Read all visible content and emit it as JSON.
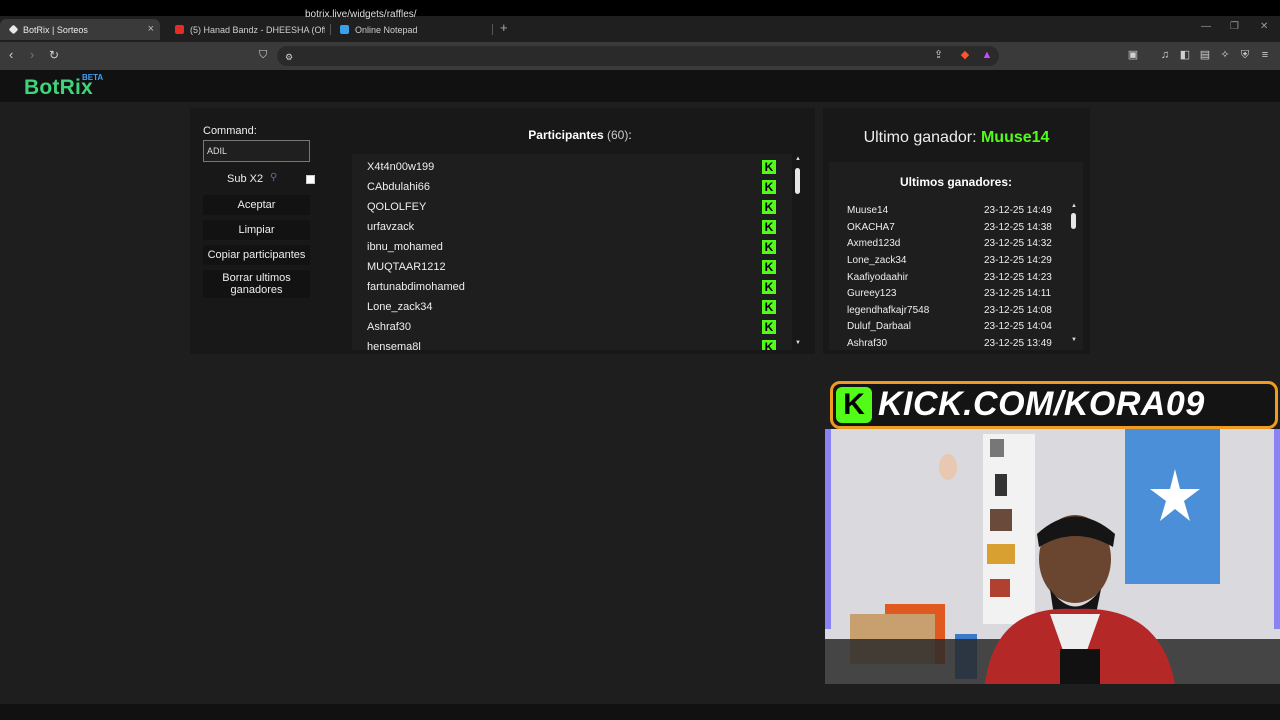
{
  "browser": {
    "tabs": [
      {
        "title": "BotRix | Sorteos",
        "fav_color": "#e8e8e8"
      },
      {
        "title": "(5) Hanad Bandz - DHEESHA (Official",
        "fav_color": "#e52d27"
      },
      {
        "title": "Online Notepad",
        "fav_color": "#3aa0e8"
      }
    ],
    "url": "botrix.live/widgets/raffles/"
  },
  "site": {
    "logo": "BotRix",
    "beta": "BETA"
  },
  "controls": {
    "command_label": "Command:",
    "command_value": "ADIL",
    "sub_label": "Sub X2",
    "sub_checked": false,
    "buttons": {
      "accept": "Aceptar",
      "clear": "Limpiar",
      "copy": "Copiar participantes",
      "delete": "Borrar ultimos ganadores"
    }
  },
  "participants": {
    "title": "Participantes",
    "count": "(60)",
    "suffix": ":",
    "list": [
      "X4t4n00w199",
      "CAbdulahi66",
      "QOLOLFEY",
      "urfavzack",
      "ibnu_mohamed",
      "MUQTAAR1212",
      "fartunabdimohamed",
      "Lone_zack34",
      "Ashraf30",
      "hensema8l"
    ],
    "platform_badge": "K"
  },
  "winners": {
    "last_label": "Ultimo ganador:",
    "last_name": "Muuse14",
    "title": "Ultimos ganadores:",
    "rows": [
      {
        "name": "Muuse14",
        "date": "23-12-25 14:49"
      },
      {
        "name": "OKACHA7",
        "date": "23-12-25 14:38"
      },
      {
        "name": "Axmed123d",
        "date": "23-12-25 14:32"
      },
      {
        "name": "Lone_zack34",
        "date": "23-12-25 14:29"
      },
      {
        "name": "Kaafiyodaahir",
        "date": "23-12-25 14:23"
      },
      {
        "name": "Gureey123",
        "date": "23-12-25 14:11"
      },
      {
        "name": "legendhafkajr7548",
        "date": "23-12-25 14:08"
      },
      {
        "name": "Duluf_Darbaal",
        "date": "23-12-25 14:04"
      },
      {
        "name": "Ashraf30",
        "date": "23-12-25 13:49"
      }
    ]
  },
  "overlay": {
    "kick_logo": "K",
    "kick_text": "KICK.COM/KORA09"
  },
  "colors": {
    "brand_green": "#3fd47a",
    "kick_green": "#53fc18",
    "banner_border": "#f09a22"
  }
}
